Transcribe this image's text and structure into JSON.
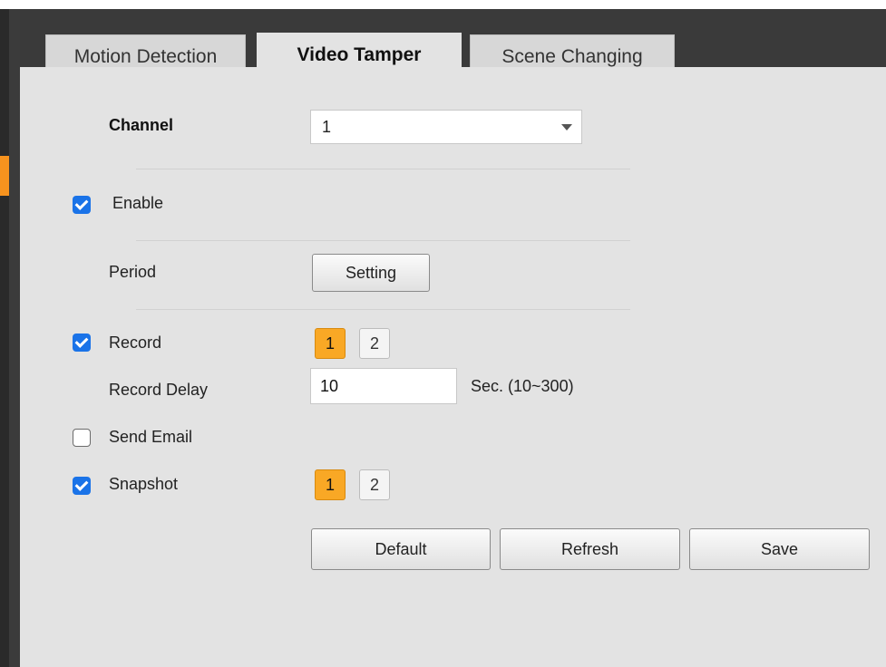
{
  "tabs": [
    {
      "label": "Motion Detection",
      "active": false
    },
    {
      "label": "Video Tamper",
      "active": true
    },
    {
      "label": "Scene Changing",
      "active": false
    }
  ],
  "channel": {
    "label": "Channel",
    "value": "1"
  },
  "enable": {
    "label": "Enable",
    "checked": true
  },
  "period": {
    "label": "Period",
    "button": "Setting"
  },
  "record": {
    "label": "Record",
    "checked": true,
    "channels": [
      "1",
      "2"
    ],
    "selected": "1"
  },
  "record_delay": {
    "label": "Record Delay",
    "value": "10",
    "unit": "Sec. (10~300)"
  },
  "send_email": {
    "label": "Send Email",
    "checked": false
  },
  "snapshot": {
    "label": "Snapshot",
    "checked": true,
    "channels": [
      "1",
      "2"
    ],
    "selected": "1"
  },
  "actions": {
    "default": "Default",
    "refresh": "Refresh",
    "save": "Save"
  },
  "colors": {
    "accent": "#f7931e",
    "checkbox": "#1a73e8",
    "selected_channel": "#f9a825"
  }
}
